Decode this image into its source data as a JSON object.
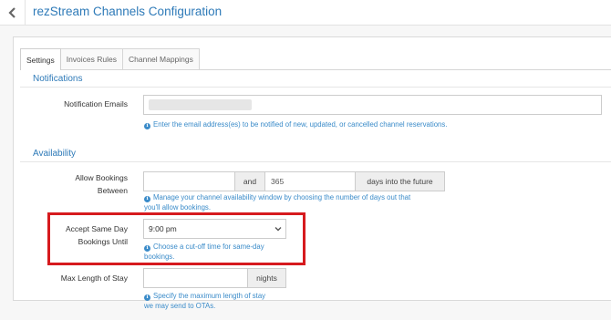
{
  "header": {
    "title": "rezStream Channels Configuration"
  },
  "tabs": [
    {
      "label": "Settings"
    },
    {
      "label": "Invoices Rules"
    },
    {
      "label": "Channel Mappings"
    }
  ],
  "notifications": {
    "section_title": "Notifications",
    "emails_label": "Notification Emails",
    "emails_help": "Enter the email address(es) to be notified of new, updated, or cancelled channel reservations."
  },
  "availability": {
    "section_title": "Availability",
    "allow_bookings": {
      "label_line1": "Allow Bookings",
      "label_line2": "Between",
      "from_value": "",
      "and_label": "and",
      "to_value": "365",
      "suffix": "days into the future",
      "help_line1": "Manage your channel availability window by choosing the number of days out that",
      "help_line2": "you'll allow bookings."
    },
    "same_day": {
      "label_line1": "Accept Same Day",
      "label_line2": "Bookings Until",
      "selected": "9:00 pm",
      "help_line1": "Choose a cut-off time for same-day",
      "help_line2": "bookings."
    },
    "max_stay": {
      "label": "Max Length of Stay",
      "value": "",
      "suffix": "nights",
      "help_line1": "Specify the maximum length of stay",
      "help_line2": "we may send to OTAs."
    }
  },
  "colors": {
    "accent": "#2e7ab8",
    "help_text": "#3a8bc9",
    "highlight": "#d61a1e"
  },
  "icons": [
    "chevron-left-icon",
    "info-icon",
    "chevron-down-icon"
  ]
}
